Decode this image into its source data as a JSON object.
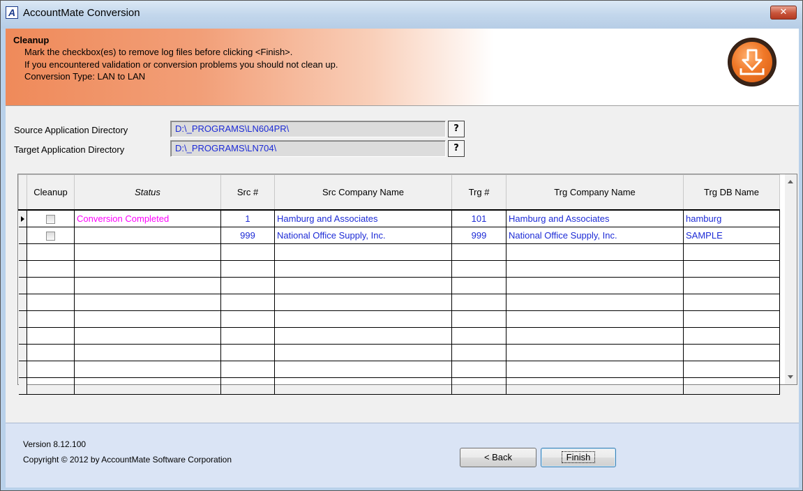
{
  "window": {
    "title": "AccountMate Conversion",
    "close_glyph": "✕",
    "app_icon_letter": "A"
  },
  "header": {
    "title": "Cleanup",
    "lines": [
      "Mark the checkbox(es) to remove log files before clicking <Finish>.",
      "If you encountered validation or conversion problems you should not clean up.",
      "Conversion Type: LAN to LAN"
    ],
    "badge_icon": "download-icon"
  },
  "directories": {
    "source_label": "Source Application Directory",
    "source_value": "D:\\_PROGRAMS\\LN604PR\\",
    "target_label": "Target Application Directory",
    "target_value": "D:\\_PROGRAMS\\LN704\\",
    "help_label": "?"
  },
  "grid": {
    "columns": [
      "Cleanup",
      "Status",
      "Src #",
      "Src Company Name",
      "Trg #",
      "Trg Company Name",
      "Trg DB Name"
    ],
    "rows": [
      {
        "cleanup": false,
        "status": "Conversion Completed",
        "src_no": "1",
        "src_name": "Hamburg and Associates",
        "trg_no": "101",
        "trg_name": "Hamburg and Associates",
        "trg_db": "hamburg"
      },
      {
        "cleanup": false,
        "status": "",
        "src_no": "999",
        "src_name": "National Office Supply, Inc.",
        "trg_no": "999",
        "trg_name": "National Office Supply, Inc.",
        "trg_db": "SAMPLE"
      }
    ],
    "status_color": "#ff00ff",
    "value_color": "#1d2bd6"
  },
  "footer": {
    "version": "Version 8.12.100",
    "copyright": "Copyright © 2012 by AccountMate Software Corporation",
    "back_label": "< Back",
    "finish_label": "Finish"
  }
}
